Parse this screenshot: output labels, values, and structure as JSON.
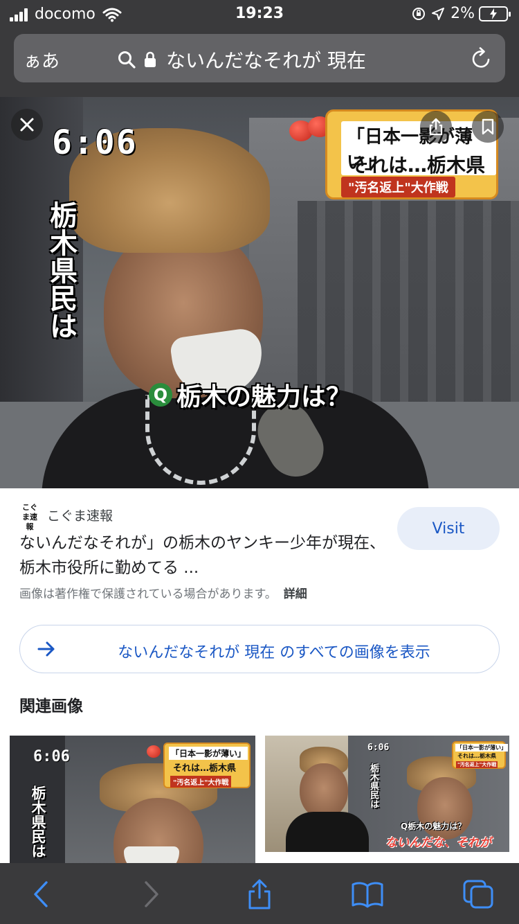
{
  "status_bar": {
    "carrier": "docomo",
    "time": "19:23",
    "battery_percent": "2%"
  },
  "url_bar": {
    "text_size_label": "ぁあ",
    "query": "ないんだなそれが 現在"
  },
  "photo": {
    "osd_time": "6:06",
    "osd_vertical_text": "栃木県民は",
    "osd_question": "栃木の魅力は？",
    "osd_question_badge": "Q",
    "banner_line1": "「日本一影が薄い」",
    "banner_line2": "それは…栃木県",
    "banner_line3": "\"汚名返上\"大作戦"
  },
  "result": {
    "source_logo": "こぐま速報",
    "source_name": "こぐま速報",
    "title": "ないんだなそれが」の栃木のヤンキー少年が現在、栃木市役所に勤めてる ...",
    "copyright_notice": "画像は著作権で保護されている場合があります。",
    "details_link": "詳細",
    "visit_label": "Visit"
  },
  "see_all": {
    "label": "ないんだなそれが 現在 のすべての画像を表示"
  },
  "related": {
    "heading": "関連画像",
    "thumb1": {
      "time": "6:06",
      "vertical": "栃木県民は",
      "banner1": "「日本一影が薄い」",
      "banner2": "それは…栃木県",
      "banner3": "\"汚名返上\"大作戦"
    },
    "thumb2": {
      "time": "6:06",
      "vertical": "栃木県民は",
      "banner1": "「日本一影が薄い」",
      "banner2": "それは…栃木県",
      "banner3": "\"汚名返上\"大作戦",
      "question": "Q栃木の魅力は？",
      "caption": "ないんだな、それが"
    }
  },
  "colors": {
    "chrome_bg": "#3a3a3c",
    "url_bar_bg": "#636366",
    "accent_blue": "#1a57c4",
    "toolbar_icon_blue": "#3e8ef7",
    "visit_bg": "#e8eef9"
  },
  "icons": {
    "close": "close-icon",
    "share": "share-icon",
    "bookmark": "bookmark-icon",
    "search": "search-icon",
    "lock": "lock-icon",
    "reload": "reload-icon",
    "arrow": "arrow-right-icon",
    "back": "back-chevron-icon",
    "forward": "forward-chevron-icon",
    "toolbar_share": "share-icon",
    "bookmarks": "book-icon",
    "tabs": "tabs-icon"
  }
}
